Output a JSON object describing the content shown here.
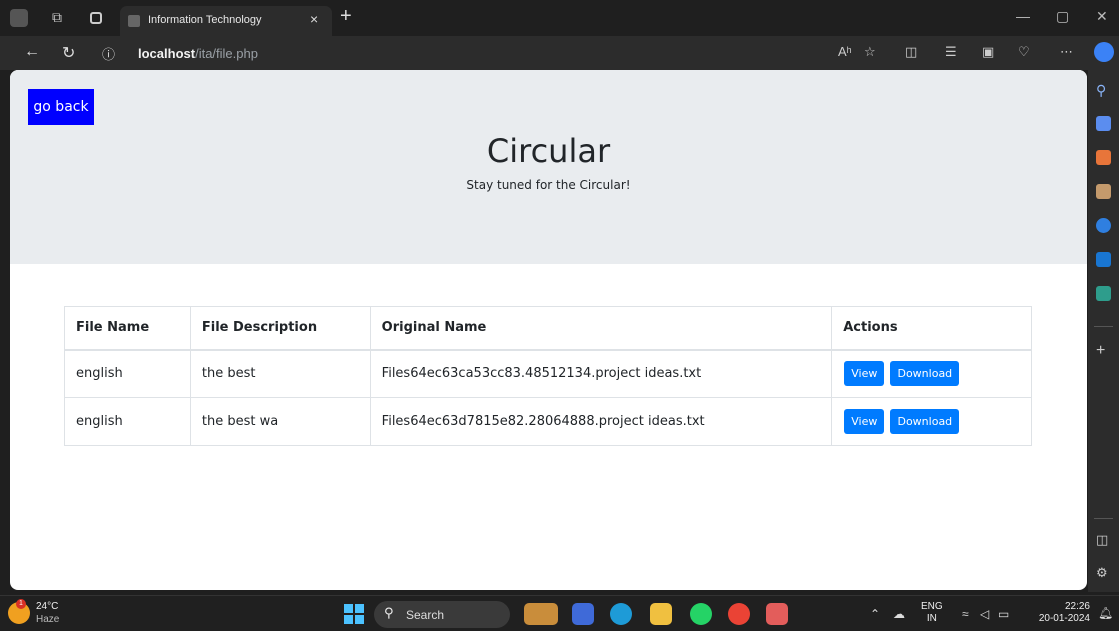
{
  "browser": {
    "tab_title": "Information Technology",
    "tab_close": "×",
    "new_tab": "+",
    "url_host": "localhost",
    "url_path": "/ita/file.php",
    "read_aloud": "Aʰ"
  },
  "page": {
    "go_back_label": "go back",
    "title": "Circular",
    "subtitle": "Stay tuned for the Circular!",
    "table": {
      "headers": [
        "File Name",
        "File Description",
        "Original Name",
        "Actions"
      ],
      "rows": [
        {
          "file_name": "english",
          "description": "the best",
          "original_name": "Files64ec63ca53cc83.48512134.project ideas.txt"
        },
        {
          "file_name": "english",
          "description": "the best wa",
          "original_name": "Files64ec63d7815e82.28064888.project ideas.txt"
        }
      ],
      "view_label": "View",
      "download_label": "Download"
    }
  },
  "taskbar": {
    "temperature": "24°C",
    "weather": "Haze",
    "weather_badge": "1",
    "search_label": "Search",
    "lang_top": "ENG",
    "lang_bottom": "IN",
    "time": "22:26",
    "date": "20-01-2024"
  },
  "colors": {
    "go_back_bg": "#0000ff",
    "button_bg": "#007bff",
    "jumbotron_bg": "#e9ecef"
  }
}
